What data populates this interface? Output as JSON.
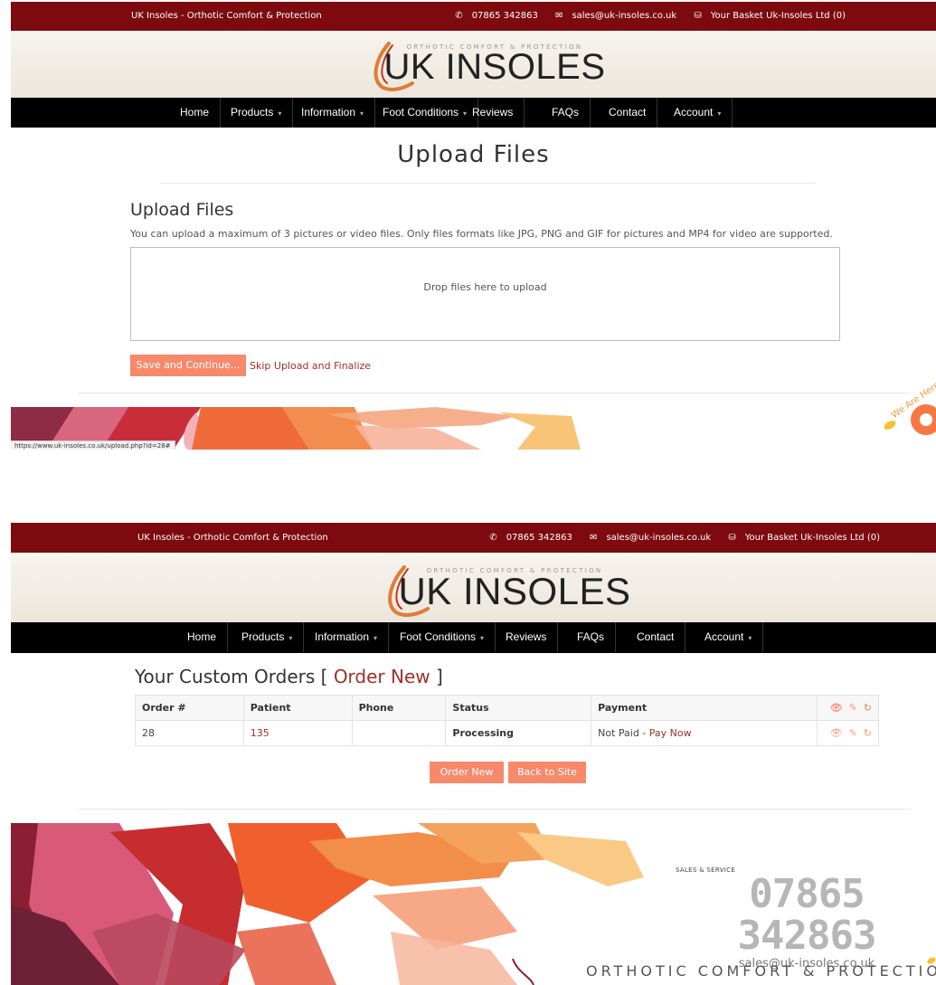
{
  "site": {
    "tagline": "UK Insoles - Orthotic Comfort & Protection",
    "phone": "07865 342863",
    "email": "sales@uk-insoles.co.uk",
    "basket": "Your Basket Uk-Insoles Ltd (0)",
    "logo_small": "ORTHOTIC COMFORT & PROTECTION",
    "logo_big": "UK INSOLES"
  },
  "nav": {
    "items": [
      {
        "label": "Home"
      },
      {
        "label": "Products"
      },
      {
        "label": "Information"
      },
      {
        "label": "Foot Conditions"
      },
      {
        "label": "Reviews"
      },
      {
        "label": "FAQs"
      },
      {
        "label": "Contact"
      },
      {
        "label": "Account"
      }
    ]
  },
  "upload": {
    "page_title": "Upload Files",
    "section_title": "Upload Files",
    "help": "You can upload a maximum of 3 pictures or video files. Only files formats like JPG, PNG and GIF for pictures and MP4 for video are supported.",
    "dropzone": "Drop files here to upload",
    "save_button": "Save and Continue...",
    "skip_link": "Skip Upload and Finalize",
    "status_url": "https://www.uk-insoles.co.uk/upload.php?id=28#"
  },
  "orders": {
    "title_prefix": "Your Custom Orders [",
    "title_link": "Order New",
    "title_suffix": "]",
    "columns": [
      "Order #",
      "Patient",
      "Phone",
      "Status",
      "Payment"
    ],
    "rows": [
      {
        "order": "28",
        "patient": "135",
        "phone": "",
        "status": "Processing",
        "payment_status": "Not Paid",
        "separator": "-",
        "pay_link": "Pay Now"
      }
    ],
    "order_new_button": "Order New",
    "back_button": "Back to Site"
  },
  "footer": {
    "sales_label": "SALES & SERVICE",
    "phone": "07865 342863",
    "email": "sales@uk-insoles.co.uk",
    "tagline": "ORTHOTIC COMFORT & PROTECTION"
  },
  "chat": {
    "label": "We Are Here"
  },
  "icons": {
    "phone": "phone-icon",
    "email": "envelope-icon",
    "basket": "basket-icon",
    "view": "eye-icon",
    "edit": "pencil-icon",
    "refresh": "refresh-icon"
  },
  "colors": {
    "brand": "#7d0a0e",
    "button": "#f7896b",
    "link": "#a0302a"
  }
}
